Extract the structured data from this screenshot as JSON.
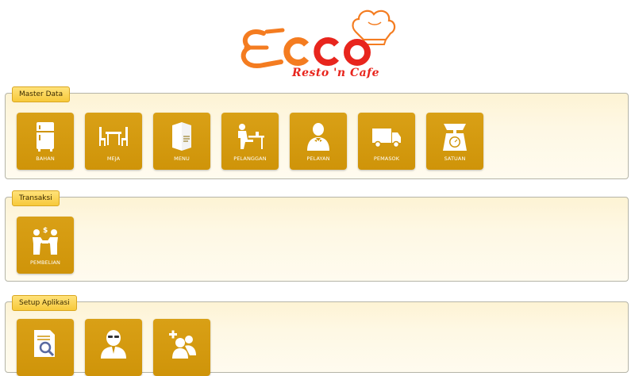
{
  "brand": {
    "name": "ECCO",
    "tagline": "Resto 'n Cafe",
    "colors": {
      "orange": "#f47c20",
      "red": "#e8251d"
    }
  },
  "sections": [
    {
      "title": "Master Data",
      "tiles": [
        {
          "label": "BAHAN",
          "icon": "refrigerator-icon"
        },
        {
          "label": "MEJA",
          "icon": "table-chairs-icon"
        },
        {
          "label": "MENU",
          "icon": "menu-book-icon"
        },
        {
          "label": "PELANGGAN",
          "icon": "customer-at-table-icon"
        },
        {
          "label": "PELAYAN",
          "icon": "waiter-icon"
        },
        {
          "label": "PEMASOK",
          "icon": "delivery-truck-icon"
        },
        {
          "label": "SATUAN",
          "icon": "weighing-scale-icon"
        }
      ]
    },
    {
      "title": "Transaksi",
      "tiles": [
        {
          "label": "PEMBELIAN",
          "icon": "purchase-exchange-icon"
        }
      ]
    },
    {
      "title": "Setup Aplikasi",
      "tiles": [
        {
          "label": "",
          "icon": "document-search-icon"
        },
        {
          "label": "",
          "icon": "user-profile-icon"
        },
        {
          "label": "",
          "icon": "add-users-icon"
        }
      ]
    }
  ],
  "theme": {
    "tile_color": "#d39a0e",
    "panel_bg": "#fdf3d4",
    "panel_title_bg": "#fbd24f"
  }
}
